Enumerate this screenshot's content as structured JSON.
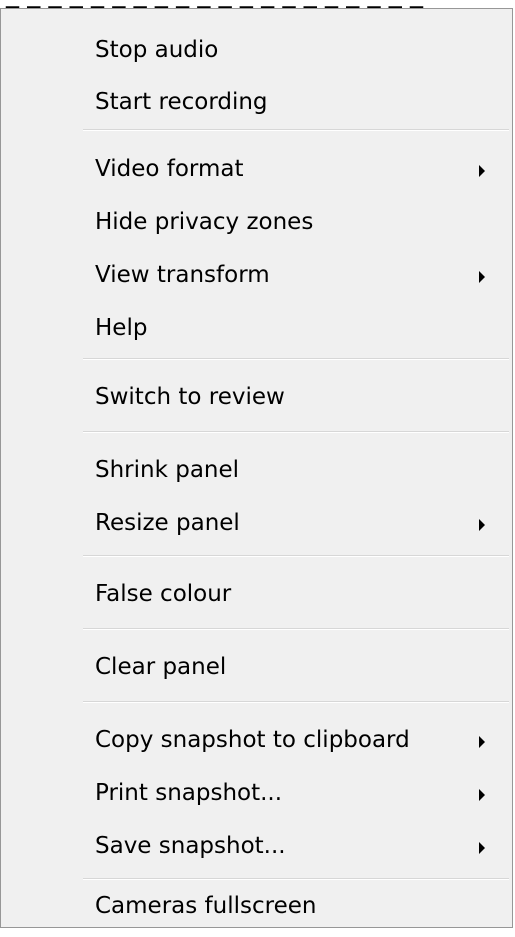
{
  "menu": {
    "items": [
      {
        "label": "Stop audio",
        "submenu": false
      },
      {
        "label": "Start recording",
        "submenu": false
      },
      {
        "label": "Video format",
        "submenu": true
      },
      {
        "label": "Hide privacy zones",
        "submenu": false
      },
      {
        "label": "View transform",
        "submenu": true
      },
      {
        "label": "Help",
        "submenu": false
      },
      {
        "label": "Switch to review",
        "submenu": false
      },
      {
        "label": "Shrink panel",
        "submenu": false
      },
      {
        "label": "Resize panel",
        "submenu": true
      },
      {
        "label": "False colour",
        "submenu": false
      },
      {
        "label": "Clear panel",
        "submenu": false
      },
      {
        "label": "Copy snapshot to clipboard",
        "submenu": true
      },
      {
        "label": "Print snapshot...",
        "submenu": true
      },
      {
        "label": "Save snapshot...",
        "submenu": true
      },
      {
        "label": "Cameras fullscreen",
        "submenu": false
      }
    ]
  }
}
